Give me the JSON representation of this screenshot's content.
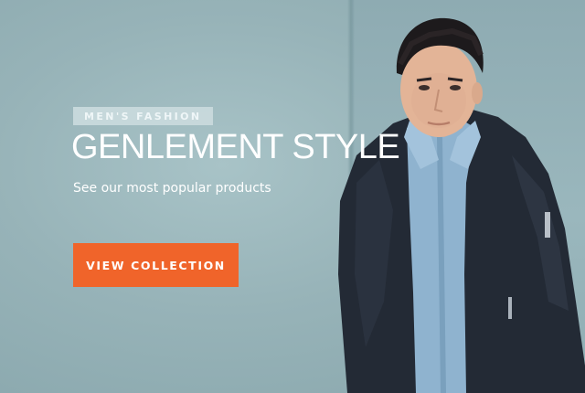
{
  "hero": {
    "eyebrow": "MEN'S FASHION",
    "headline": "GENLEMENT STYLE",
    "subtext": "See our most popular products",
    "cta_label": "VIEW COLLECTION"
  },
  "colors": {
    "background": "#9fb9bf",
    "accent": "#f0642a",
    "eyebrow_bg": "#c9dadd",
    "text": "#ffffff"
  },
  "image": {
    "subject": "model-photo"
  }
}
